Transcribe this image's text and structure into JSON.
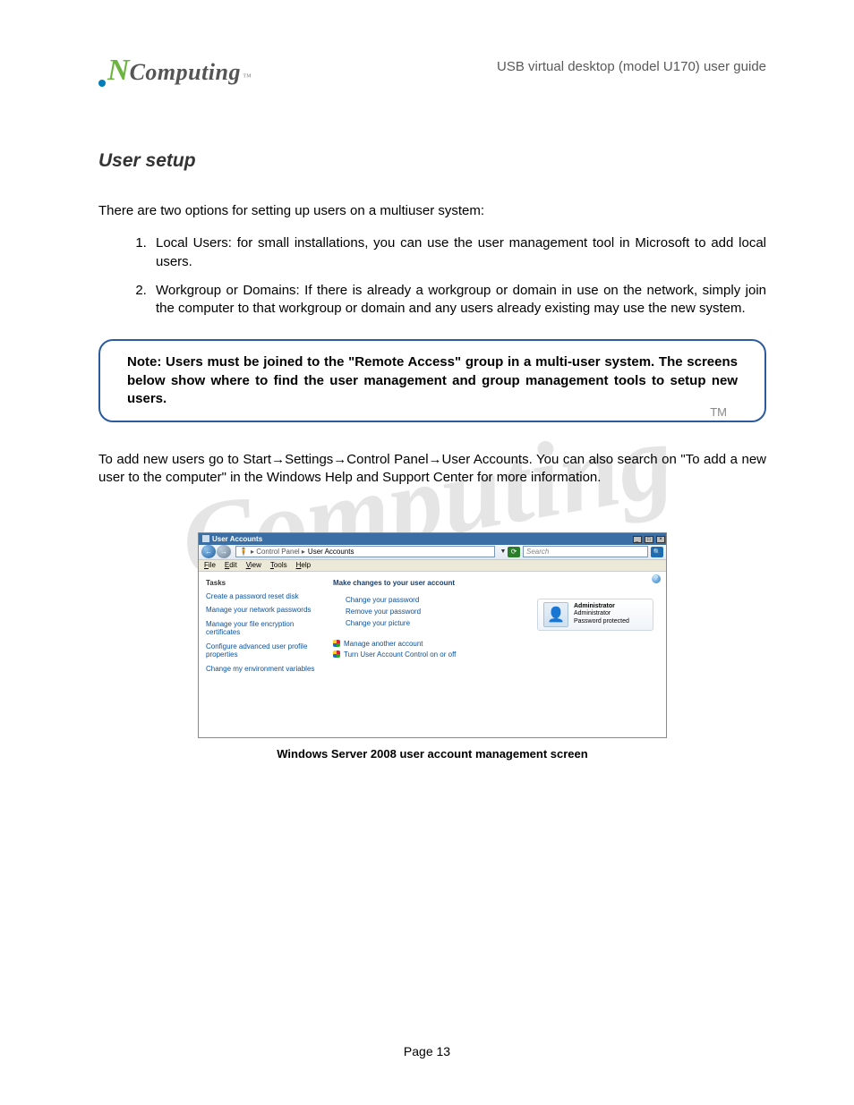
{
  "header": {
    "guide": "USB virtual desktop (model U170) user guide",
    "logo_brand_n": "N",
    "logo_brand_text": "Computing",
    "logo_tm": "™"
  },
  "section_title": "User setup",
  "intro": "There are two options for setting up users on a multiuser system:",
  "list": [
    "Local Users: for small installations, you can use the user management tool in Microsoft to add local users.",
    "Workgroup or Domains: If there is already a workgroup or domain in use on the network, simply join the computer to that workgroup or domain and any users already existing may use the new system."
  ],
  "note": "Note: Users must be joined to the \"Remote Access\" group in a multi-user system. The screens below show where to find the user management and group management tools to setup new users.",
  "followup": "To add new users go to Start→Settings→Control Panel→User Accounts. You can also search on \"To add a new user to the computer\" in the Windows Help and Support Center for more information.",
  "screenshot": {
    "title": "User Accounts",
    "breadcrumb_prefix": "▸ Control Panel ▸",
    "breadcrumb_current": "User Accounts",
    "search_placeholder": "Search",
    "menus": {
      "file": "File",
      "edit": "Edit",
      "view": "View",
      "tools": "Tools",
      "help": "Help"
    },
    "tasks_title": "Tasks",
    "task_links": [
      "Create a password reset disk",
      "Manage your network passwords",
      "Manage your file encryption certificates",
      "Configure advanced user profile properties",
      "Change my environment variables"
    ],
    "main_title": "Make changes to your user account",
    "main_links": [
      "Change your password",
      "Remove your password",
      "Change your picture"
    ],
    "shield_links": [
      "Manage another account",
      "Turn User Account Control on or off"
    ],
    "account": {
      "name": "Administrator",
      "role": "Administrator",
      "status": "Password protected"
    }
  },
  "caption": "Windows Server 2008 user account management screen",
  "page_number": "Page 13",
  "watermark": "Computing"
}
